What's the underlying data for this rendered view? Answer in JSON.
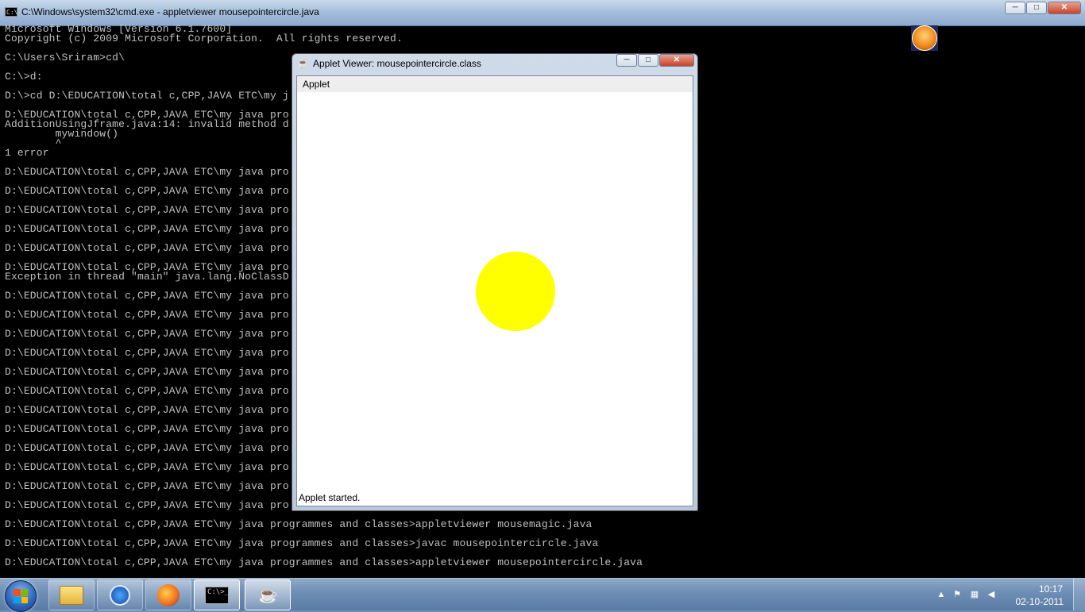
{
  "cmd_window": {
    "title": "C:\\Windows\\system32\\cmd.exe - appletviewer  mousepointercircle.java",
    "lines": [
      "Microsoft Windows [Version 6.1.7600]",
      "Copyright (c) 2009 Microsoft Corporation.  All rights reserved.",
      "",
      "C:\\Users\\Sriram>cd\\",
      "",
      "C:\\>d:",
      "",
      "D:\\>cd D:\\EDUCATION\\total c,CPP,JAVA ETC\\my j",
      "",
      "D:\\EDUCATION\\total c,CPP,JAVA ETC\\my java pro",
      "AdditionUsingJframe.java:14: invalid method d",
      "        mywindow()",
      "        ^",
      "1 error",
      "",
      "D:\\EDUCATION\\total c,CPP,JAVA ETC\\my java pro",
      "",
      "D:\\EDUCATION\\total c,CPP,JAVA ETC\\my java pro",
      "",
      "D:\\EDUCATION\\total c,CPP,JAVA ETC\\my java pro",
      "",
      "D:\\EDUCATION\\total c,CPP,JAVA ETC\\my java pro",
      "",
      "D:\\EDUCATION\\total c,CPP,JAVA ETC\\my java pro",
      "",
      "D:\\EDUCATION\\total c,CPP,JAVA ETC\\my java pro",
      "Exception in thread \"main\" java.lang.NoClassD",
      "",
      "D:\\EDUCATION\\total c,CPP,JAVA ETC\\my java pro",
      "",
      "D:\\EDUCATION\\total c,CPP,JAVA ETC\\my java pro",
      "",
      "D:\\EDUCATION\\total c,CPP,JAVA ETC\\my java pro",
      "",
      "D:\\EDUCATION\\total c,CPP,JAVA ETC\\my java pro",
      "",
      "D:\\EDUCATION\\total c,CPP,JAVA ETC\\my java pro",
      "",
      "D:\\EDUCATION\\total c,CPP,JAVA ETC\\my java pro",
      "",
      "D:\\EDUCATION\\total c,CPP,JAVA ETC\\my java pro",
      "",
      "D:\\EDUCATION\\total c,CPP,JAVA ETC\\my java pro",
      "",
      "D:\\EDUCATION\\total c,CPP,JAVA ETC\\my java pro",
      "",
      "D:\\EDUCATION\\total c,CPP,JAVA ETC\\my java pro",
      "",
      "D:\\EDUCATION\\total c,CPP,JAVA ETC\\my java pro",
      "",
      "D:\\EDUCATION\\total c,CPP,JAVA ETC\\my java pro",
      "",
      "D:\\EDUCATION\\total c,CPP,JAVA ETC\\my java programmes and classes>appletviewer mousemagic.java",
      "",
      "D:\\EDUCATION\\total c,CPP,JAVA ETC\\my java programmes and classes>javac mousepointercircle.java",
      "",
      "D:\\EDUCATION\\total c,CPP,JAVA ETC\\my java programmes and classes>appletviewer mousepointercircle.java"
    ],
    "caption": {
      "minimize": "─",
      "maximize": "□",
      "close": "✕"
    }
  },
  "applet_window": {
    "title": "Applet Viewer: mousepointercircle.class",
    "menu": "Applet",
    "status": "Applet started.",
    "circle_color": "#ffff00",
    "caption": {
      "minimize": "─",
      "maximize": "□",
      "close": "✕"
    }
  },
  "taskbar": {
    "clock_time": "10:17",
    "clock_date": "02-10-2011",
    "cmd_icon_text": "C:\\>_",
    "buttons": [
      "folder-icon",
      "media-center-icon",
      "firefox-icon",
      "cmd-icon",
      "java-icon"
    ]
  },
  "colors": {
    "console_bg": "#000000",
    "console_text": "#c0c0c0",
    "circle": "#ffff00"
  }
}
